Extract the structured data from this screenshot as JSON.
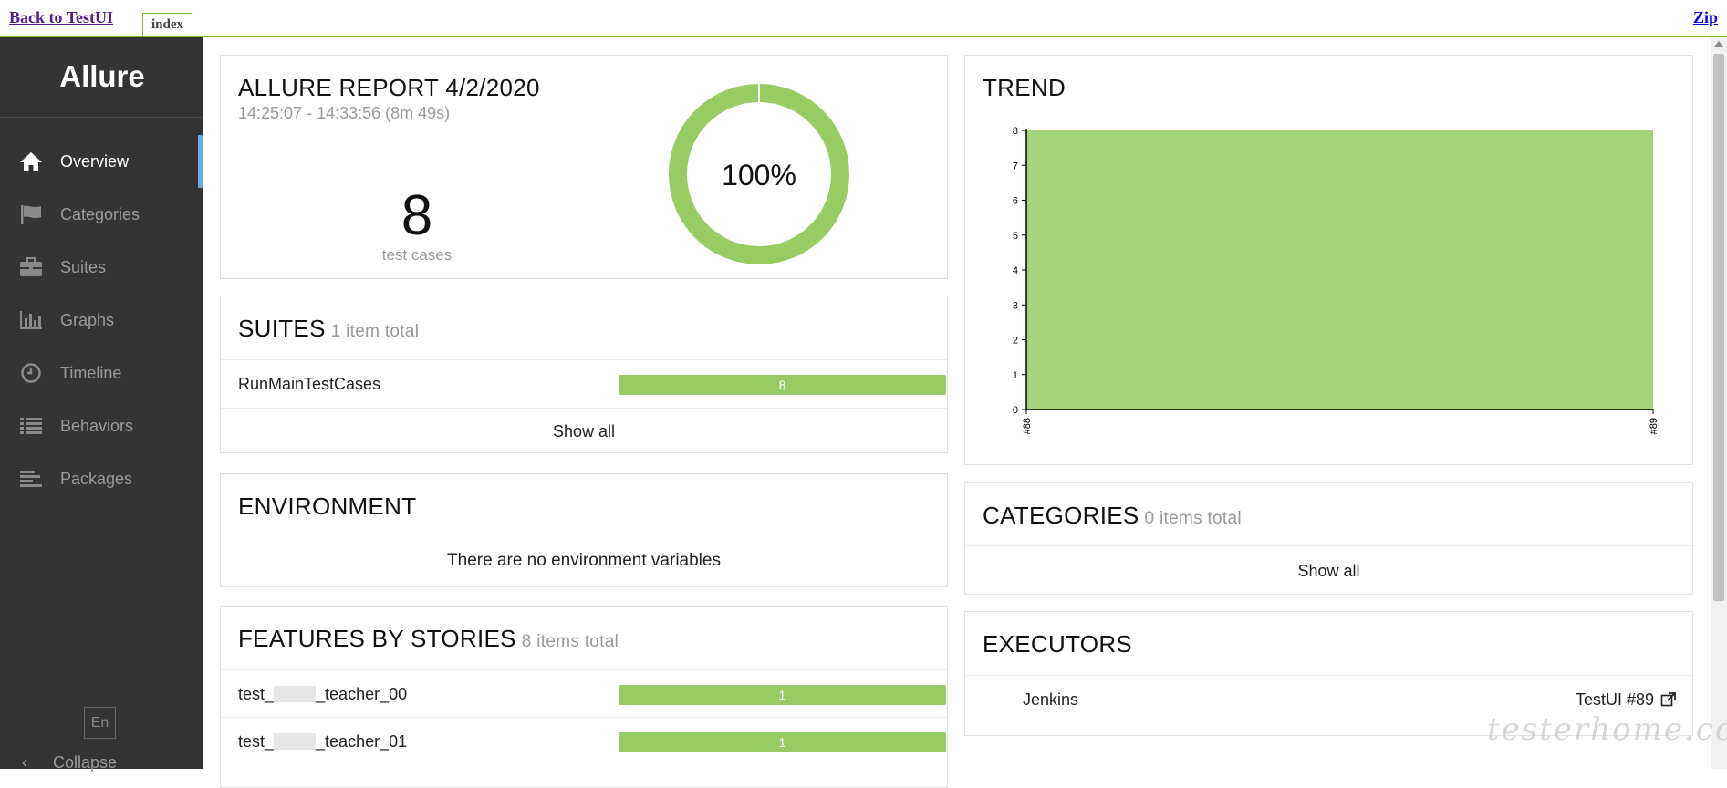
{
  "topbar": {
    "back_label": "Back to TestUI",
    "tab_label": "index",
    "zip_label": "Zip"
  },
  "sidebar": {
    "brand": "Allure",
    "items": [
      {
        "label": "Overview",
        "icon": "home-icon",
        "active": true
      },
      {
        "label": "Categories",
        "icon": "flag-icon",
        "active": false
      },
      {
        "label": "Suites",
        "icon": "briefcase-icon",
        "active": false
      },
      {
        "label": "Graphs",
        "icon": "bar-chart-icon",
        "active": false
      },
      {
        "label": "Timeline",
        "icon": "clock-icon",
        "active": false
      },
      {
        "label": "Behaviors",
        "icon": "list-icon",
        "active": false
      },
      {
        "label": "Packages",
        "icon": "align-left-icon",
        "active": false
      }
    ],
    "lang": "En",
    "collapse_label": "Collapse"
  },
  "summary": {
    "title": "ALLURE REPORT 4/2/2020",
    "time": "14:25:07 - 14:33:56 (8m 49s)",
    "count": "8",
    "count_label": "test cases",
    "percent": "100%",
    "pass_fraction": 1.0,
    "color": "#97cc64"
  },
  "suites": {
    "title": "SUITES",
    "subtitle": "1 item total",
    "rows": [
      {
        "name": "RunMainTestCases",
        "value": "8"
      }
    ],
    "show_all": "Show all"
  },
  "environment": {
    "title": "ENVIRONMENT",
    "message": "There are no environment variables"
  },
  "features": {
    "title": "FEATURES BY STORIES",
    "subtitle": "8 items total",
    "rows": [
      {
        "name_prefix": "test_",
        "name_suffix": "_teacher_00",
        "value": "1"
      },
      {
        "name_prefix": "test_",
        "name_suffix": "_teacher_01",
        "value": "1"
      }
    ]
  },
  "trend": {
    "title": "TREND"
  },
  "categories": {
    "title": "CATEGORIES",
    "subtitle": "0 items total",
    "show_all": "Show all"
  },
  "executors": {
    "title": "EXECUTORS",
    "name": "Jenkins",
    "link": "TestUI #89"
  },
  "watermark": "testerhome.com",
  "chart_data": {
    "type": "area",
    "title": "TREND",
    "x": [
      "#88",
      "#89"
    ],
    "series": [
      {
        "values": [
          8,
          8
        ],
        "color": "#a5d57b"
      }
    ],
    "ylim": [
      0,
      8
    ],
    "yticks": [
      "0",
      "1",
      "2",
      "3",
      "4",
      "5",
      "6",
      "7",
      "8"
    ],
    "xlabel": "",
    "ylabel": "",
    "grid": false
  }
}
